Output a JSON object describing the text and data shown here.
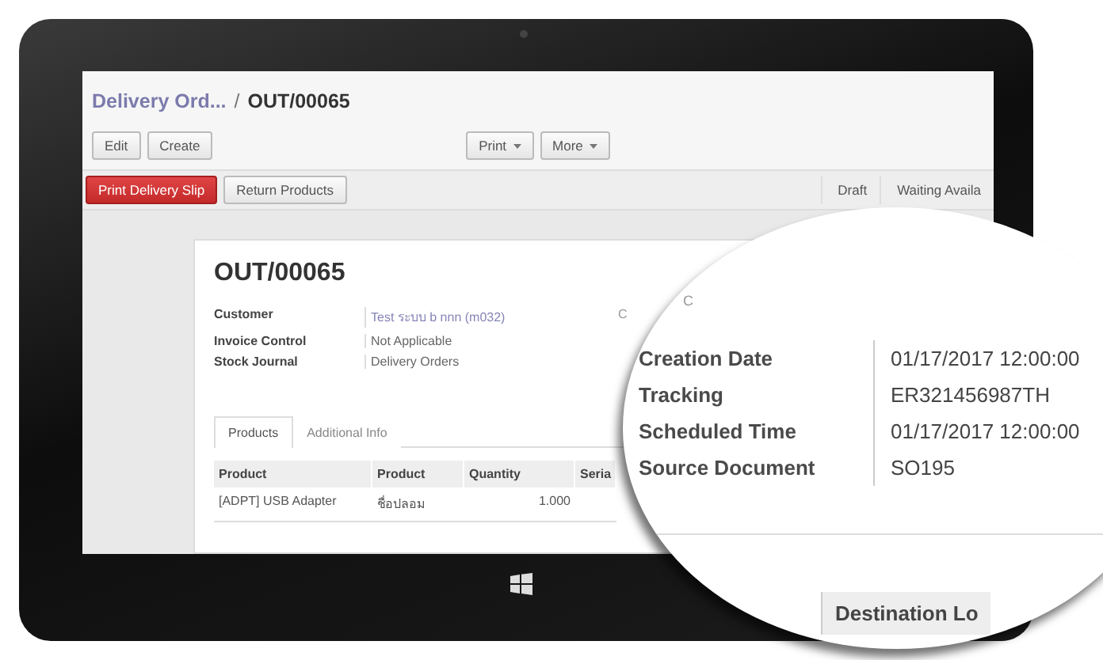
{
  "breadcrumb": {
    "parent": "Delivery Ord...",
    "separator": "/",
    "current": "OUT/00065"
  },
  "toolbar": {
    "left": [
      {
        "label": "Edit",
        "kind": "plain"
      },
      {
        "label": "Create",
        "kind": "plain"
      }
    ],
    "right": [
      {
        "label": "Print",
        "kind": "dropdown"
      },
      {
        "label": "More",
        "kind": "dropdown"
      }
    ]
  },
  "actions": [
    {
      "label": "Print Delivery Slip",
      "primary": true
    },
    {
      "label": "Return Products",
      "primary": false
    }
  ],
  "statusbar": [
    "Draft",
    "Waiting Availa"
  ],
  "record": {
    "title": "OUT/00065",
    "partial_label": "C",
    "fields": [
      {
        "label": "Customer",
        "value": "Test ระบบ b nnn (m032)",
        "link": true
      },
      {
        "label": "Invoice Control",
        "value": "Not Applicable",
        "link": false
      },
      {
        "label": "Stock Journal",
        "value": "Delivery Orders",
        "link": false
      }
    ]
  },
  "tabs": [
    {
      "label": "Products",
      "selected": true
    },
    {
      "label": "Additional Info",
      "selected": false
    }
  ],
  "table": {
    "columns": [
      "Product",
      "Product",
      "Quantity",
      "Seria"
    ],
    "rows": [
      [
        "[ADPT] USB Adapter",
        "ชื่อปลอม",
        "1.000"
      ]
    ]
  },
  "magnifier": {
    "partial_label": "C",
    "fields": [
      {
        "label": "Creation Date",
        "value": "01/17/2017 12:00:00"
      },
      {
        "label": "Tracking",
        "value": "ER321456987TH"
      },
      {
        "label": "Scheduled Time",
        "value": "01/17/2017 12:00:00"
      },
      {
        "label": "Source Document",
        "value": "SO195"
      }
    ],
    "column": "Destination Lo"
  }
}
